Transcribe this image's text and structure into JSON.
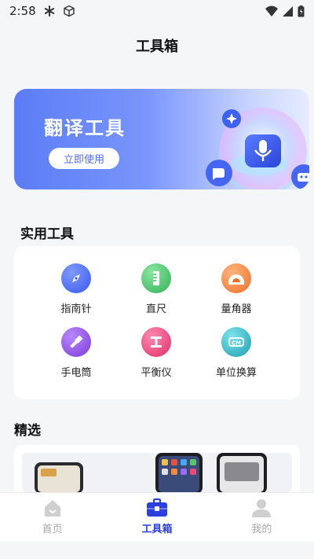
{
  "status_bar": {
    "time": "2:58"
  },
  "page_title": "工具箱",
  "banner": {
    "title": "翻译工具",
    "button_label": "立即使用"
  },
  "tools_section": {
    "title": "实用工具",
    "items": [
      {
        "label": "指南针",
        "icon": "compass-icon",
        "color": "#4a6cf7"
      },
      {
        "label": "直尺",
        "icon": "ruler-icon",
        "color": "#44c66a"
      },
      {
        "label": "量角器",
        "icon": "protractor-icon",
        "color": "#f07b3f"
      },
      {
        "label": "手电筒",
        "icon": "flashlight-icon",
        "color": "#8b4ddf"
      },
      {
        "label": "平衡仪",
        "icon": "level-icon",
        "color": "#e5407a"
      },
      {
        "label": "单位换算",
        "icon": "unit-converter-icon",
        "color": "#22a9b8"
      }
    ]
  },
  "featured_section": {
    "title": "精选"
  },
  "bottom_nav": {
    "items": [
      {
        "label": "首页",
        "active": false
      },
      {
        "label": "工具箱",
        "active": true
      },
      {
        "label": "我的",
        "active": false
      }
    ]
  },
  "colors": {
    "accent": "#2b3fdc",
    "banner_start": "#5b7cf6",
    "background": "#f5f6f8"
  }
}
